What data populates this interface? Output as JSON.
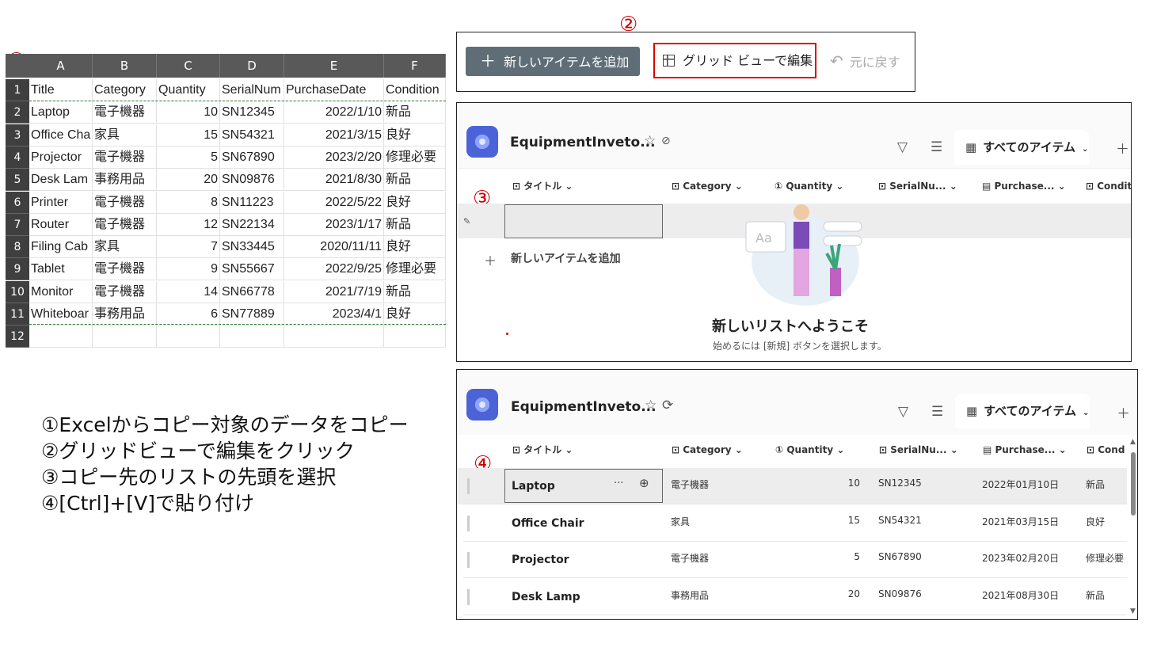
{
  "steps": {
    "labels": [
      "①",
      "②",
      "③",
      "④"
    ],
    "instructions": [
      "①Excelからコピー対象のデータをコピー",
      "②グリッドビューで編集をクリック",
      "③コピー先のリストの先頭を選択",
      "④[Ctrl]+[V]で貼り付け"
    ]
  },
  "excel": {
    "columns": [
      "A",
      "B",
      "C",
      "D",
      "E",
      "F"
    ],
    "row_numbers": [
      "1",
      "2",
      "3",
      "4",
      "5",
      "6",
      "7",
      "8",
      "9",
      "10",
      "11",
      "12"
    ],
    "header": [
      "Title",
      "Category",
      "Quantity",
      "SerialNum",
      "PurchaseDate",
      "Condition"
    ],
    "rows": [
      [
        "Laptop",
        "電子機器",
        "10",
        "SN12345",
        "2022/1/10",
        "新品"
      ],
      [
        "Office Cha",
        "家具",
        "15",
        "SN54321",
        "2021/3/15",
        "良好"
      ],
      [
        "Projector",
        "電子機器",
        "5",
        "SN67890",
        "2023/2/20",
        "修理必要"
      ],
      [
        "Desk Lam",
        "事務用品",
        "20",
        "SN09876",
        "2021/8/30",
        "新品"
      ],
      [
        "Printer",
        "電子機器",
        "8",
        "SN11223",
        "2022/5/22",
        "良好"
      ],
      [
        "Router",
        "電子機器",
        "12",
        "SN22134",
        "2023/1/17",
        "新品"
      ],
      [
        "Filing Cab",
        "家具",
        "7",
        "SN33445",
        "2020/11/11",
        "良好"
      ],
      [
        "Tablet",
        "電子機器",
        "9",
        "SN55667",
        "2022/9/25",
        "修理必要"
      ],
      [
        "Monitor",
        "電子機器",
        "14",
        "SN66778",
        "2021/7/19",
        "新品"
      ],
      [
        "Whiteboar",
        "事務用品",
        "6",
        "SN77889",
        "2023/4/1",
        "良好"
      ]
    ]
  },
  "toolbar": {
    "add_label": "新しいアイテムを追加",
    "grid_label": "グリッド ビューで編集",
    "undo_label": "元に戻す"
  },
  "list": {
    "title": "EquipmentInveto...",
    "view_label": "すべてのアイテム",
    "columns_step3": [
      "タイトル",
      "Category",
      "Quantity",
      "SerialNu...",
      "Purchase...",
      "Condit"
    ],
    "columns_step4": [
      "タイトル",
      "Category",
      "Quantity",
      "SerialNu...",
      "Purchase...",
      "Cond"
    ],
    "add_item": "新しいアイテムを追加",
    "welcome_title": "新しいリストへようこそ",
    "welcome_sub": "始めるには [新規] ボタンを選択します。",
    "rows": [
      {
        "title": "Laptop",
        "category": "電子機器",
        "quantity": "10",
        "serial": "SN12345",
        "date": "2022年01月10日",
        "condition": "新品"
      },
      {
        "title": "Office Chair",
        "category": "家具",
        "quantity": "15",
        "serial": "SN54321",
        "date": "2021年03月15日",
        "condition": "良好"
      },
      {
        "title": "Projector",
        "category": "電子機器",
        "quantity": "5",
        "serial": "SN67890",
        "date": "2023年02月20日",
        "condition": "修理必要"
      },
      {
        "title": "Desk Lamp",
        "category": "事務用品",
        "quantity": "20",
        "serial": "SN09876",
        "date": "2021年08月30日",
        "condition": "新品"
      }
    ]
  },
  "colors": {
    "accent_red": "#d00000",
    "add_button": "#5f6e76",
    "app_icon": "#4b63d6"
  }
}
